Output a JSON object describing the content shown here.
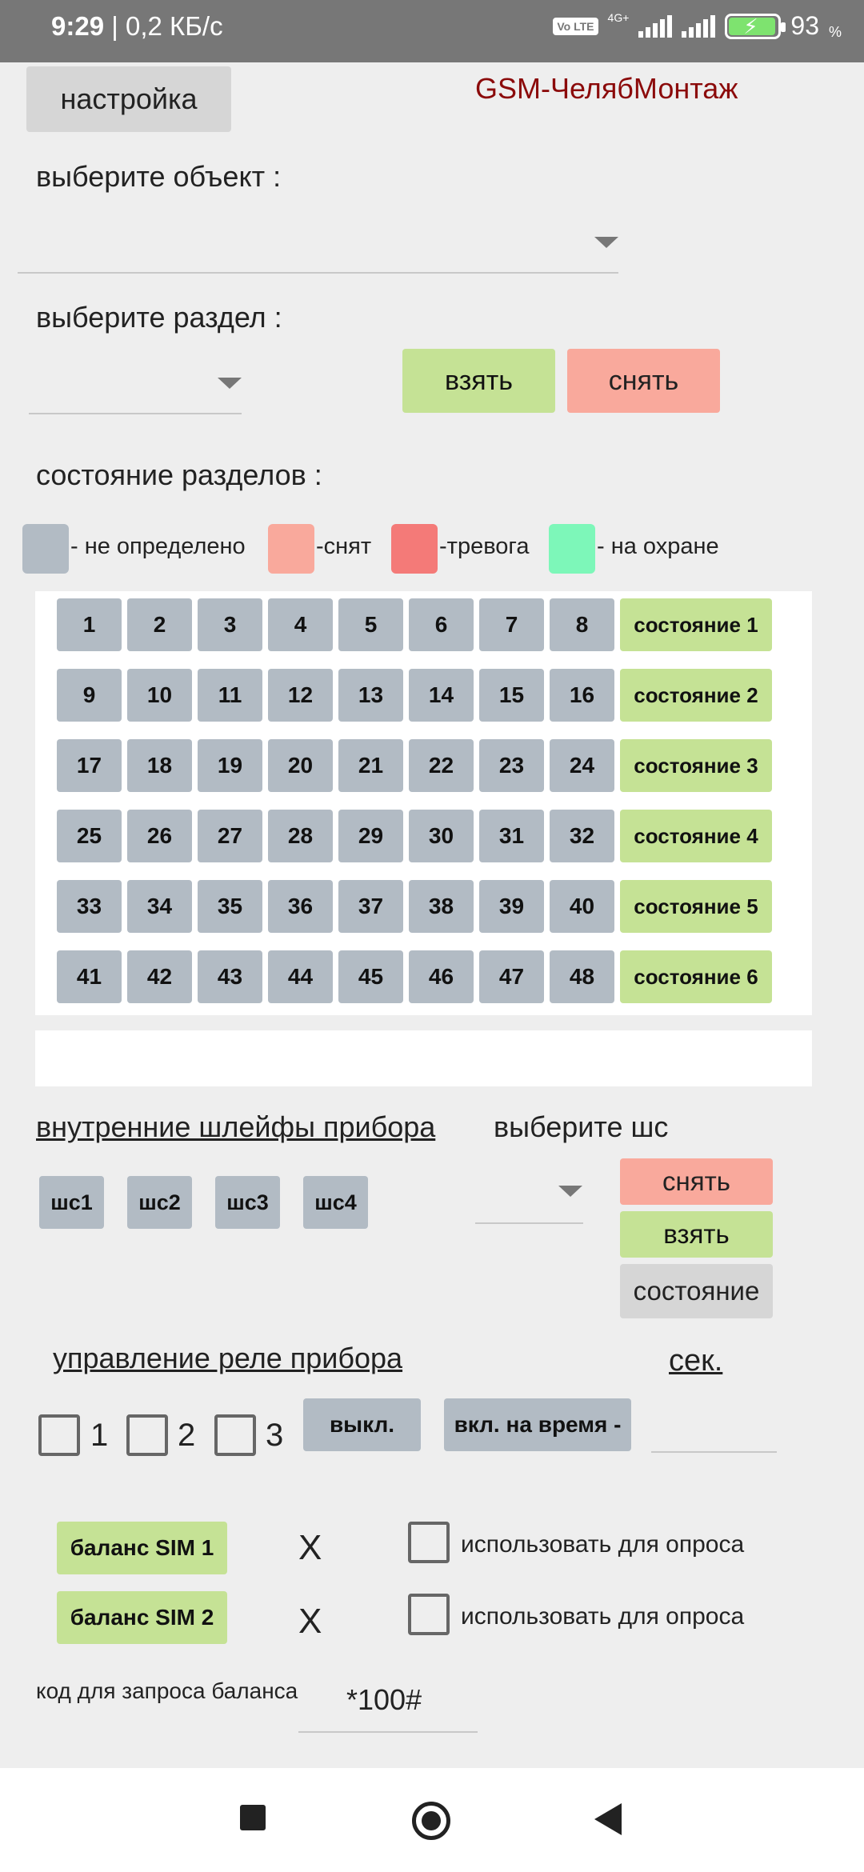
{
  "status_bar": {
    "time": "9:29",
    "speed": "| 0,2 КБ/с",
    "volte": "Vo LTE",
    "network": "4G+",
    "battery": "93",
    "battery_unit": "%"
  },
  "header": {
    "settings_label": "настройка",
    "brand": "GSM-ЧелябМонтаж",
    "brand_color": "#8b0a0a"
  },
  "object": {
    "label": "выберите объект :",
    "value": ""
  },
  "section": {
    "label": "выберите раздел :",
    "value": "",
    "arm_label": "взять",
    "disarm_label": "снять"
  },
  "states": {
    "title": "состояние разделов :",
    "legend": [
      {
        "text": "- не определено",
        "color": "#b2bbc4"
      },
      {
        "text": "-снят",
        "color": "#f9a99c"
      },
      {
        "text": "-тревога",
        "color": "#f47a78"
      },
      {
        "text": "- на охране",
        "color": "#7df7b9"
      }
    ],
    "rows": [
      {
        "cells": [
          "1",
          "2",
          "3",
          "4",
          "5",
          "6",
          "7",
          "8"
        ],
        "button": "состояние 1"
      },
      {
        "cells": [
          "9",
          "10",
          "11",
          "12",
          "13",
          "14",
          "15",
          "16"
        ],
        "button": "состояние 2"
      },
      {
        "cells": [
          "17",
          "18",
          "19",
          "20",
          "21",
          "22",
          "23",
          "24"
        ],
        "button": "состояние 3"
      },
      {
        "cells": [
          "25",
          "26",
          "27",
          "28",
          "29",
          "30",
          "31",
          "32"
        ],
        "button": "состояние 4"
      },
      {
        "cells": [
          "33",
          "34",
          "35",
          "36",
          "37",
          "38",
          "39",
          "40"
        ],
        "button": "состояние 5"
      },
      {
        "cells": [
          "41",
          "42",
          "43",
          "44",
          "45",
          "46",
          "47",
          "48"
        ],
        "button": "состояние 6"
      }
    ],
    "message": ""
  },
  "loops": {
    "title": "внутренние шлейфы прибора",
    "select_label": "выберите шс",
    "items": [
      "шс1",
      "шс2",
      "шс3",
      "шс4"
    ],
    "disarm_label": "снять",
    "arm_label": "взять",
    "status_label": "состояние"
  },
  "relay": {
    "title": "управление реле прибора",
    "seconds_label": "сек.",
    "checks": [
      "1",
      "2",
      "3"
    ],
    "off_label": "выкл.",
    "on_timed_label": "вкл. на время -",
    "seconds_value": ""
  },
  "balance": {
    "sim1_label": "баланс SIM 1",
    "sim2_label": "баланс SIM 2",
    "sim1_value": "X",
    "sim2_value": "X",
    "use_for_poll": "использовать для опроса",
    "code_label": "код для запроса баланса",
    "code_value": "*100#"
  }
}
